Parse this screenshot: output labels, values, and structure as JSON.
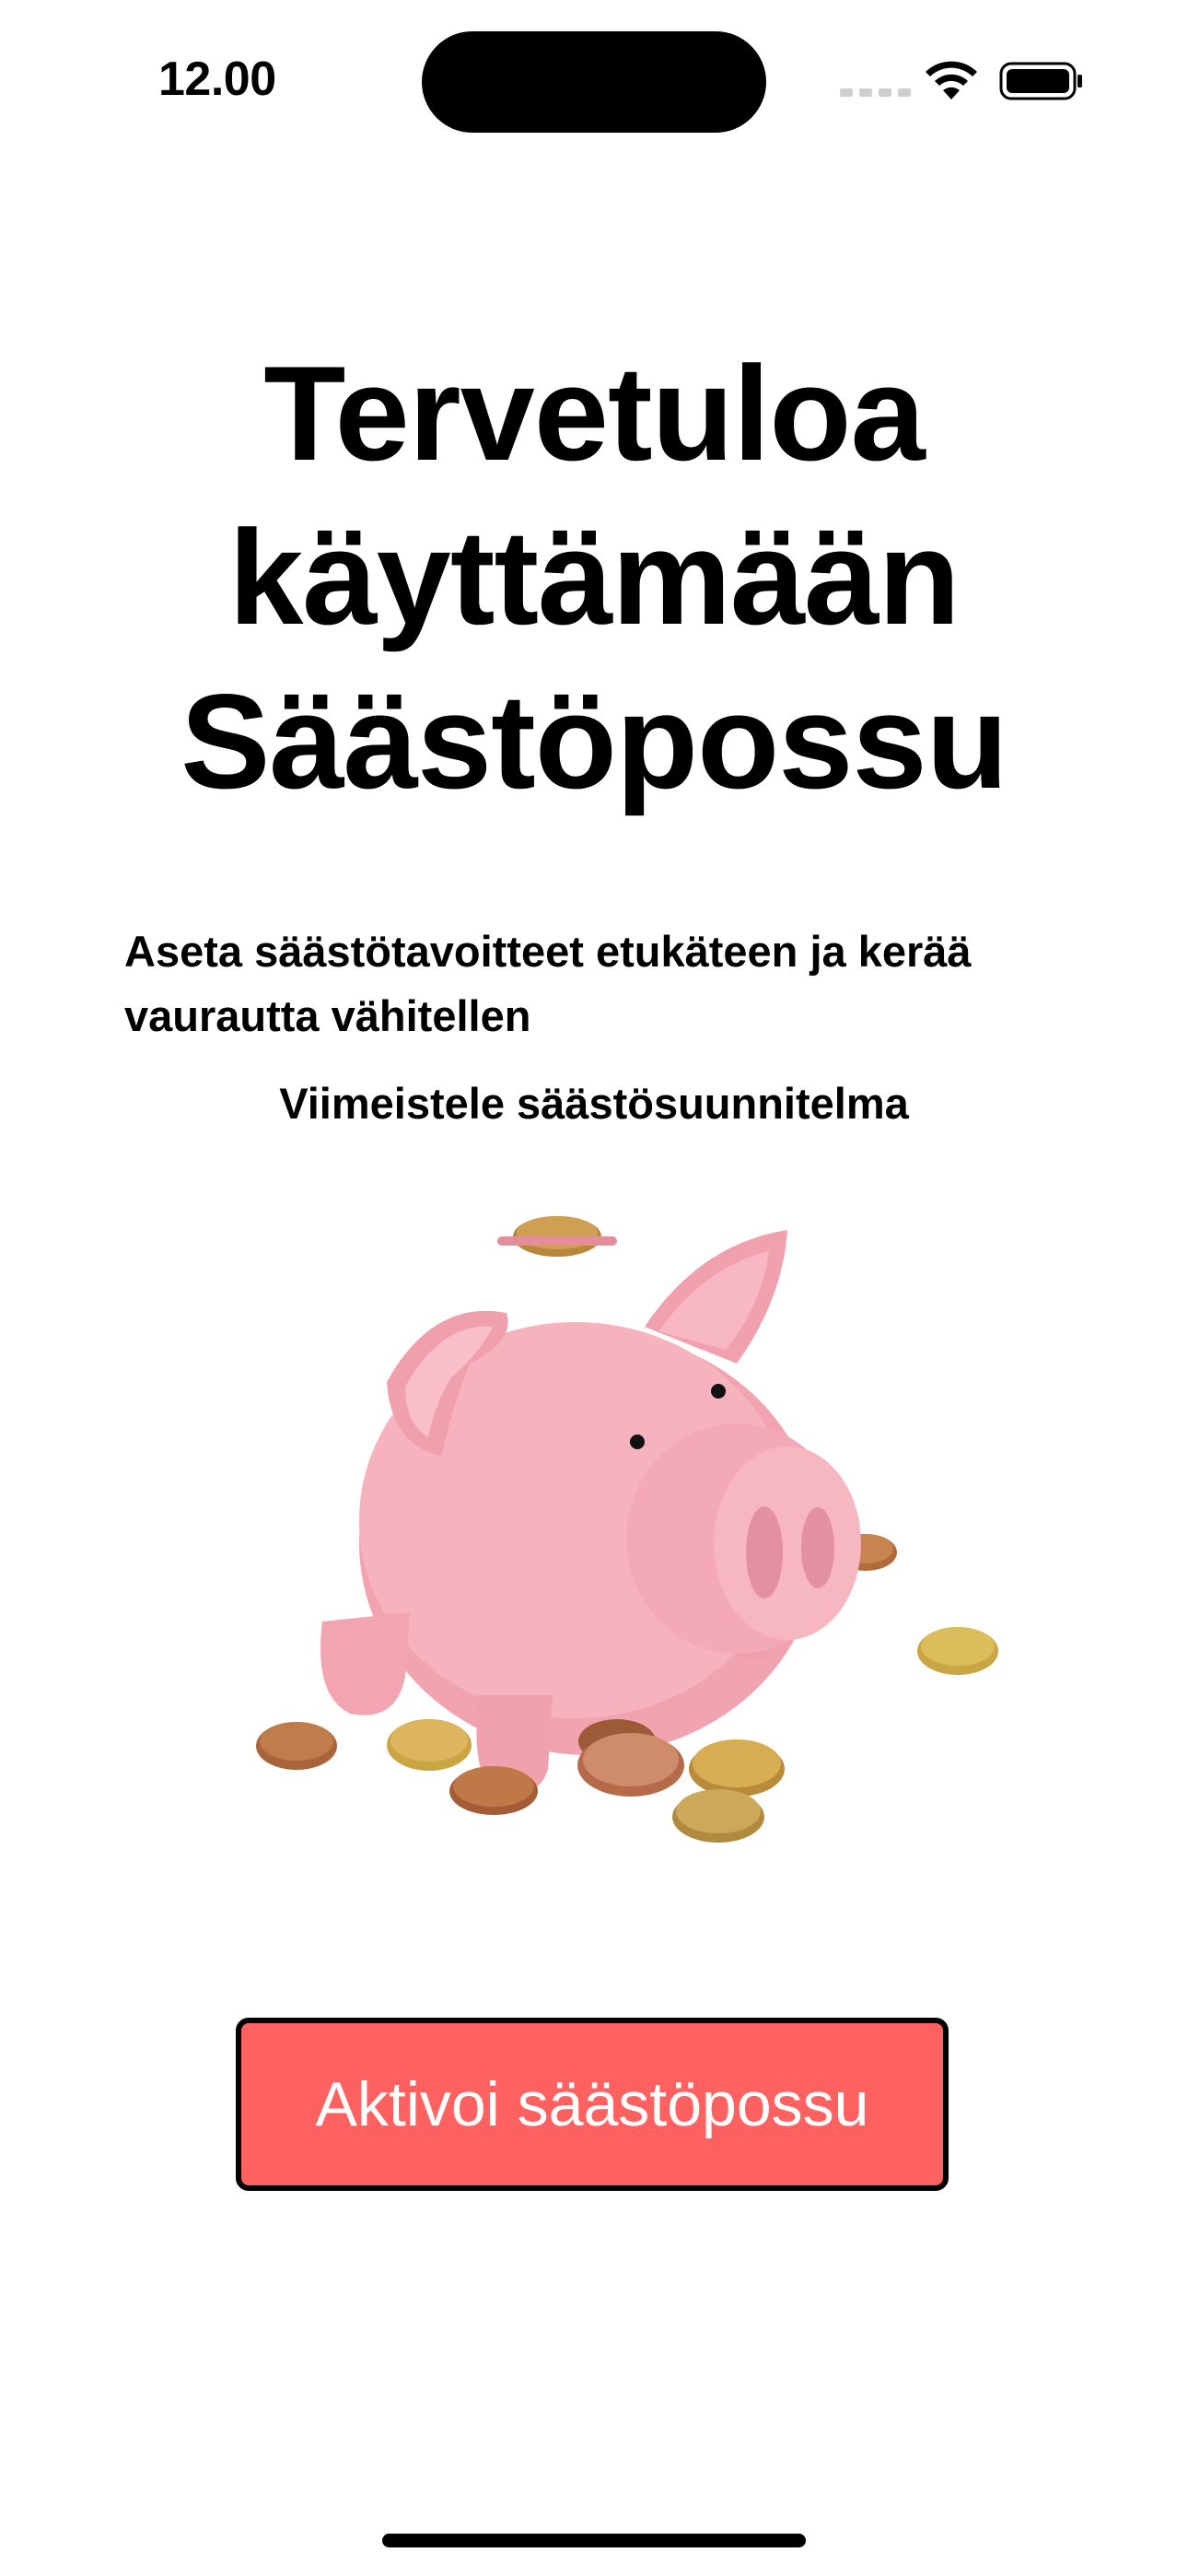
{
  "status_bar": {
    "time": "12.00",
    "icons": [
      "cellular-signal-icon",
      "wifi-icon",
      "battery-icon"
    ]
  },
  "welcome": {
    "title_lines": [
      "Tervetuloa",
      "käyttämään",
      "Säästöpossu"
    ],
    "description": "Aseta säästötavoitteet etukäteen ja kerää vaurautta vähitellen",
    "finalize_label": "Viimeistele säästösuunnitelma"
  },
  "illustration": {
    "name": "piggy-bank-with-coins",
    "colors": {
      "pig": "#f4a9b4",
      "coin_copper": "#b06a3b",
      "coin_gold": "#c9a544"
    }
  },
  "actions": {
    "activate_label": "Aktivoi säästöpossu",
    "activate_color": "#ff6161"
  }
}
